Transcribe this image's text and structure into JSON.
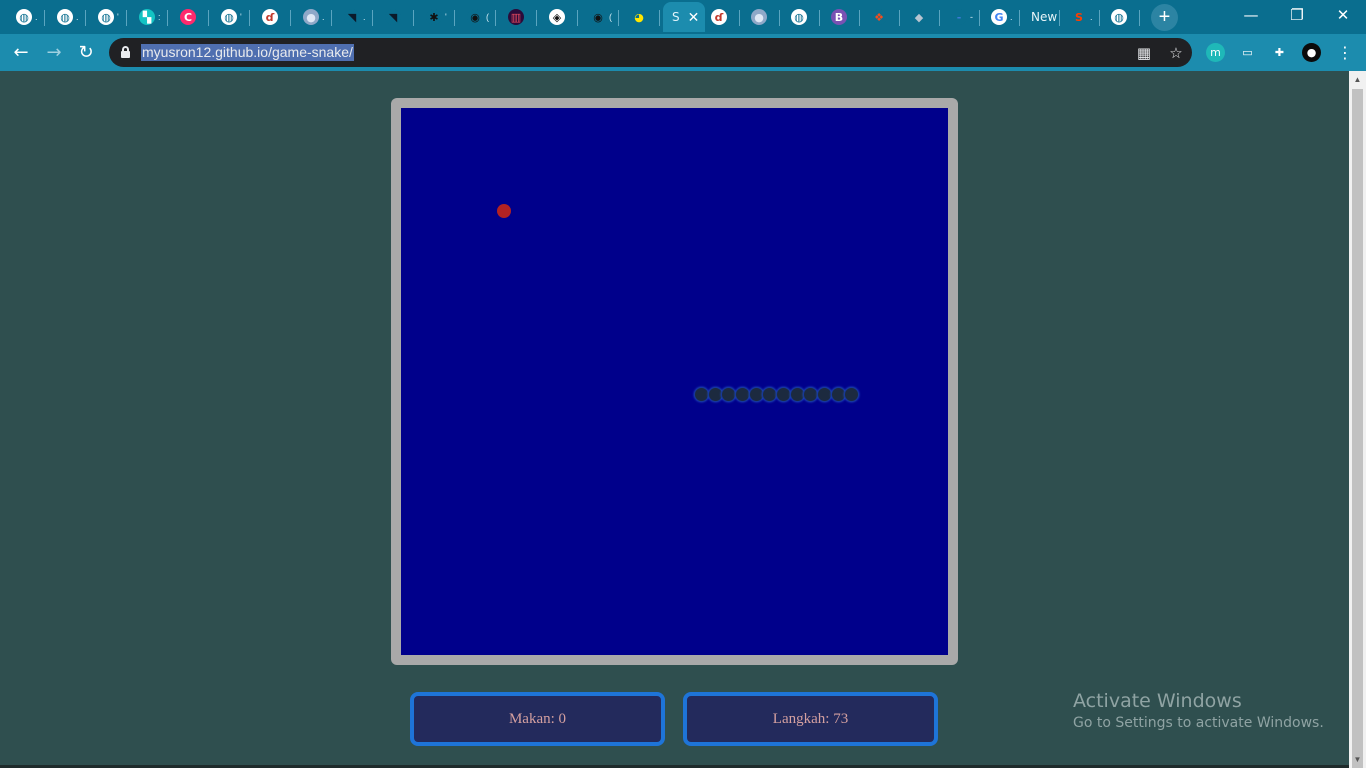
{
  "browser": {
    "tabs": [
      {
        "icon": "globe-icon",
        "glyph": "◍",
        "color": "#ffffff",
        "fg": "#0a6e8f",
        "suffix": "."
      },
      {
        "icon": "globe-icon",
        "glyph": "◍",
        "color": "#ffffff",
        "fg": "#0a6e8f",
        "suffix": "."
      },
      {
        "icon": "globe-icon",
        "glyph": "◍",
        "color": "#ffffff",
        "fg": "#0a6e8f",
        "suffix": "'"
      },
      {
        "icon": "teal-square-icon",
        "glyph": "▚",
        "color": "#13c3c3",
        "fg": "#ffffff",
        "suffix": ":"
      },
      {
        "icon": "pink-c-icon",
        "glyph": "C",
        "color": "#ff2a6d",
        "fg": "#ffffff",
        "suffix": ""
      },
      {
        "icon": "globe-icon",
        "glyph": "◍",
        "color": "#ffffff",
        "fg": "#0a6e8f",
        "suffix": "'"
      },
      {
        "icon": "flame-logo-icon",
        "glyph": "ɗ",
        "color": "#ffffff",
        "fg": "#c0392b",
        "suffix": ""
      },
      {
        "icon": "sphere-icon",
        "glyph": "●",
        "color": "#8fa8c8",
        "fg": "#dfe8f5",
        "suffix": "."
      },
      {
        "icon": "triangle-logo-icon",
        "glyph": "◥",
        "color": "#0a6e8f",
        "fg": "#0b1a2a",
        "suffix": "."
      },
      {
        "icon": "triangle-logo-icon",
        "glyph": "◥",
        "color": "#0a6e8f",
        "fg": "#0b1a2a",
        "suffix": ""
      },
      {
        "icon": "dark-dots-icon",
        "glyph": "✱",
        "color": "#0a6e8f",
        "fg": "#111111",
        "suffix": "'"
      },
      {
        "icon": "github-icon",
        "glyph": "◉",
        "color": "#0a6e8f",
        "fg": "#111111",
        "suffix": "("
      },
      {
        "icon": "barcode-icon",
        "glyph": "▥",
        "color": "#2b0b3a",
        "fg": "#e84a5f",
        "suffix": ""
      },
      {
        "icon": "codepen-icon",
        "glyph": "◈",
        "color": "#ffffff",
        "fg": "#111111",
        "suffix": ""
      },
      {
        "icon": "github-icon",
        "glyph": "◉",
        "color": "#0a6e8f",
        "fg": "#111111",
        "suffix": "("
      },
      {
        "icon": "pacman-icon",
        "glyph": "◕",
        "color": "#0a6e8f",
        "fg": "#ffe600",
        "suffix": ""
      }
    ],
    "active_tab": {
      "icon": "snake-tab-icon",
      "title": "S",
      "close": "✕"
    },
    "tabs_after": [
      {
        "icon": "flame-logo-icon",
        "glyph": "ɗ",
        "color": "#ffffff",
        "fg": "#c0392b",
        "suffix": ""
      },
      {
        "icon": "sphere-icon",
        "glyph": "●",
        "color": "#8fa8c8",
        "fg": "#dfe8f5",
        "suffix": ""
      },
      {
        "icon": "globe-icon",
        "glyph": "◍",
        "color": "#ffffff",
        "fg": "#0a6e8f",
        "suffix": ""
      },
      {
        "icon": "bootstrap-icon",
        "glyph": "B",
        "color": "#7952b3",
        "fg": "#ffffff",
        "suffix": ""
      },
      {
        "icon": "figma-icon",
        "glyph": "❖",
        "color": "#0a6e8f",
        "fg": "#f24e1e",
        "suffix": ""
      },
      {
        "icon": "layers-icon",
        "glyph": "◆",
        "color": "#0a6e8f",
        "fg": "#b8c4d0",
        "suffix": ""
      },
      {
        "icon": "dash-icon",
        "glyph": "-",
        "color": "#0a6e8f",
        "fg": "#3a7bd5",
        "suffix": "-"
      },
      {
        "icon": "google-icon",
        "glyph": "G",
        "color": "#ffffff",
        "fg": "#4285f4",
        "suffix": "."
      },
      {
        "icon": "new-tab-text-icon",
        "glyph": "New",
        "color": "#0a6e8f",
        "fg": "#e8f4f8",
        "suffix": ""
      },
      {
        "icon": "svelte-icon",
        "glyph": "S",
        "color": "#0a6e8f",
        "fg": "#ff3e00",
        "suffix": "."
      },
      {
        "icon": "globe-icon",
        "glyph": "◍",
        "color": "#ffffff",
        "fg": "#0a6e8f",
        "suffix": ""
      }
    ],
    "new_tab": "+",
    "window": {
      "minimize": "—",
      "restore": "❐",
      "close": "✕"
    },
    "nav": {
      "back": "←",
      "forward": "→",
      "reload": "↻"
    },
    "url": "myusron12.github.io/game-snake/",
    "omnibox_icons": {
      "qr": "▦",
      "star": "☆"
    },
    "extensions": [
      {
        "icon": "m-extension-icon",
        "glyph": "m",
        "color": "#1fb8b8"
      },
      {
        "icon": "pip-extension-icon",
        "glyph": "▭",
        "color": "#1c8cae"
      },
      {
        "icon": "puzzle-icon",
        "glyph": "✚",
        "color": "#1c8cae"
      },
      {
        "icon": "profile-avatar",
        "glyph": "●",
        "color": "#0b0b0b"
      }
    ],
    "menu": "⋮"
  },
  "game": {
    "food": {
      "col": 7,
      "row": 7
    },
    "snake": [
      {
        "col": 22,
        "row": 20
      },
      {
        "col": 23,
        "row": 20
      },
      {
        "col": 24,
        "row": 20
      },
      {
        "col": 25,
        "row": 20
      },
      {
        "col": 26,
        "row": 20
      },
      {
        "col": 27,
        "row": 20
      },
      {
        "col": 28,
        "row": 20
      },
      {
        "col": 29,
        "row": 20
      },
      {
        "col": 30,
        "row": 20
      },
      {
        "col": 31,
        "row": 20
      },
      {
        "col": 32,
        "row": 20
      },
      {
        "col": 33,
        "row": 20
      }
    ],
    "food_color": "#b22222",
    "board_color": "#00008b"
  },
  "score": {
    "food_text": "Makan: 0",
    "steps_text": "Langkah: 73"
  },
  "watermark": {
    "line1": "Activate Windows",
    "line2": "Go to Settings to activate Windows."
  }
}
